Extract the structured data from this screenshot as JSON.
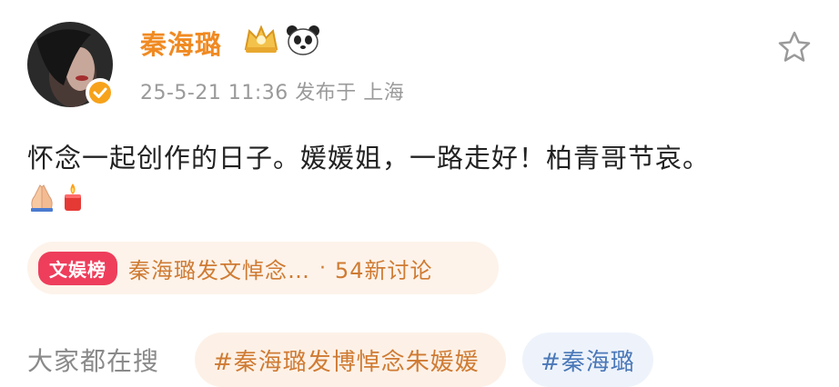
{
  "post": {
    "author": "秦海璐",
    "meta": "25-5-21 11:36  发布于 上海",
    "text": "怀念一起创作的日子。媛媛姐，一路走好！柏青哥节哀。",
    "icons": [
      "avatar-photo",
      "verified-badge-icon",
      "crown-badge-icon",
      "panda-badge-icon",
      "star-icon",
      "praying-hands-icon",
      "candle-icon"
    ]
  },
  "hot_topic": {
    "tag": "文娱榜",
    "title": "秦海璐发文悼念…",
    "dot": "·",
    "count": "54新讨论"
  },
  "search": {
    "label": "大家都在搜",
    "chips": [
      "#秦海璐发博悼念朱媛媛",
      "#秦海璐"
    ]
  },
  "colors": {
    "username": "#f08a22",
    "hot_tag_bg": "#ee3e5c",
    "hot_text": "#cf7b33",
    "chip_blue": "#4a78b8"
  }
}
